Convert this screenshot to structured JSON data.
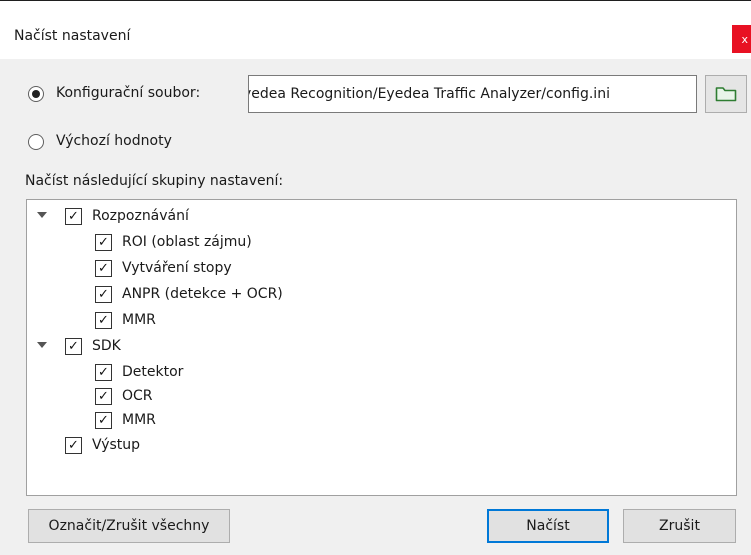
{
  "window": {
    "title": "Načíst nastavení",
    "close_label": "x"
  },
  "source": {
    "config_file_label": "Konfigurační soubor:",
    "config_file_path": "yedea Recognition/Eyedea Traffic Analyzer/config.ini",
    "defaults_label": "Výchozí hodnoty",
    "selected": "config_file"
  },
  "groups_label": "Načíst následující skupiny nastavení:",
  "tree": {
    "check_glyph": "✓",
    "rozpoznavani": {
      "label": "Rozpoznávání",
      "checked": true,
      "expanded": true,
      "children": [
        {
          "label": "ROI (oblast zájmu)",
          "checked": true
        },
        {
          "label": "Vytváření stopy",
          "checked": true
        },
        {
          "label": "ANPR (detekce + OCR)",
          "checked": true
        },
        {
          "label": "MMR",
          "checked": true
        }
      ]
    },
    "sdk": {
      "label": "SDK",
      "checked": true,
      "expanded": true,
      "children": [
        {
          "label": "Detektor",
          "checked": true
        },
        {
          "label": "OCR",
          "checked": true
        },
        {
          "label": "MMR",
          "checked": true
        }
      ]
    },
    "vystup": {
      "label": "Výstup",
      "checked": true
    }
  },
  "buttons": {
    "toggle_all": "Označit/Zrušit všechny",
    "load": "Načíst",
    "cancel": "Zrušit"
  },
  "colors": {
    "close_red": "#e81123",
    "default_button_border": "#0078d7",
    "folder_icon_green": "#2e7d32",
    "dialog_background": "#f0f0f0"
  }
}
